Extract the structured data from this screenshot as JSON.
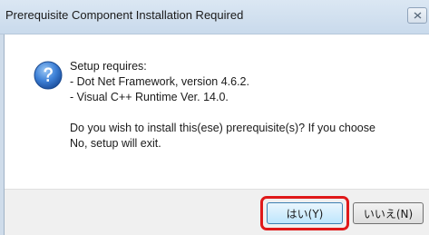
{
  "dialog": {
    "title": "Prerequisite Component Installation Required",
    "icon": "question-icon",
    "message": {
      "line1": "Setup requires:",
      "line2": " - Dot Net Framework, version 4.6.2.",
      "line3": " - Visual C++ Runtime Ver. 14.0.",
      "line4": "Do you wish to install this(ese) prerequisite(s)?  If you choose",
      "line5": "No, setup will exit."
    },
    "buttons": {
      "yes_label": "はい(Y)",
      "no_label": "いいえ(N)"
    }
  },
  "colors": {
    "highlight": "#e0191a",
    "icon_blue": "#2b6cc4"
  }
}
